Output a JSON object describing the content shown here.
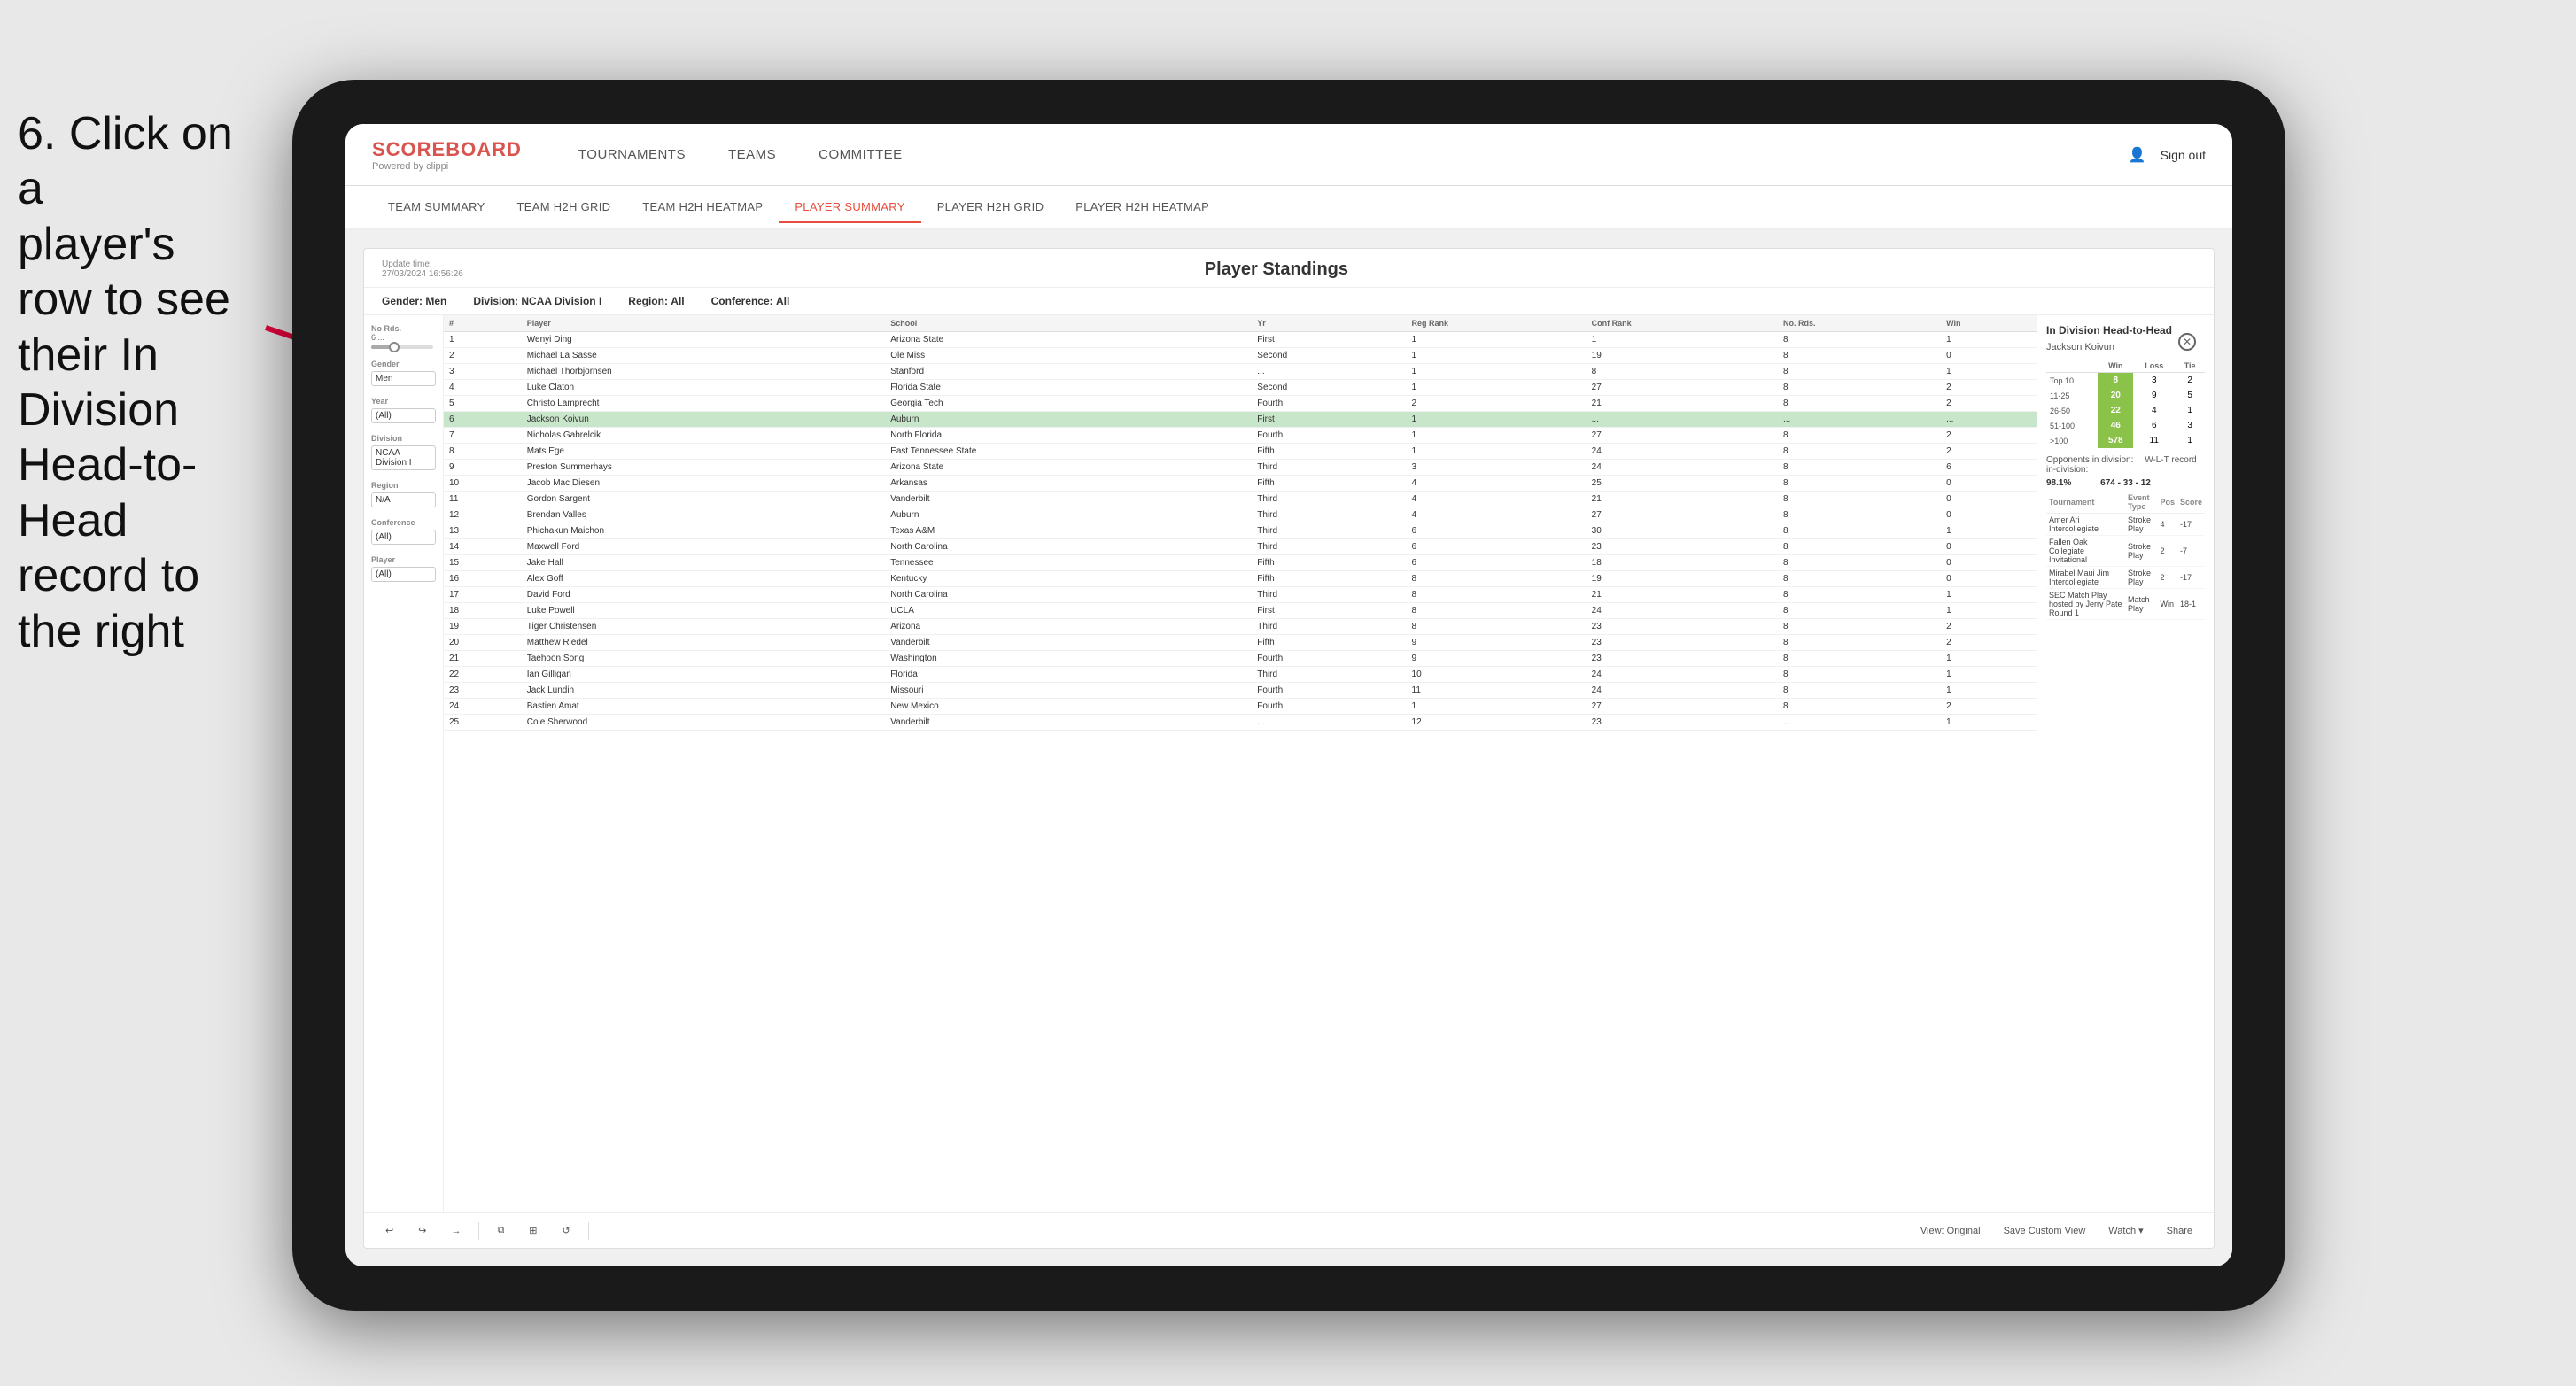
{
  "instruction": {
    "line1": "6. Click on a",
    "line2": "player's row to see",
    "line3": "their In Division",
    "line4": "Head-to-Head",
    "line5": "record to the right"
  },
  "nav": {
    "logo": "SCOREBOARD",
    "powered_by": "Powered by clippi",
    "items": [
      "TOURNAMENTS",
      "TEAMS",
      "COMMITTEE"
    ],
    "sign_out": "Sign out"
  },
  "sub_nav": {
    "items": [
      "TEAM SUMMARY",
      "TEAM H2H GRID",
      "TEAM H2H HEATMAP",
      "PLAYER SUMMARY",
      "PLAYER H2H GRID",
      "PLAYER H2H HEATMAP"
    ],
    "active": "PLAYER SUMMARY"
  },
  "panel": {
    "update_time": "Update time:",
    "update_date": "27/03/2024 16:56:26",
    "title": "Player Standings",
    "filters": {
      "gender_label": "Gender:",
      "gender_value": "Men",
      "division_label": "Division:",
      "division_value": "NCAA Division I",
      "region_label": "Region:",
      "region_value": "All",
      "conference_label": "Conference:",
      "conference_value": "All"
    }
  },
  "sidebar": {
    "no_rds_label": "No Rds.",
    "no_rds_range": "6 ...",
    "gender_label": "Gender",
    "gender_value": "Men",
    "year_label": "Year",
    "year_value": "(All)",
    "division_label": "Division",
    "division_value": "NCAA Division I",
    "region_label": "Region",
    "region_value": "N/A",
    "conference_label": "Conference",
    "conference_value": "(All)",
    "player_label": "Player",
    "player_value": "(All)"
  },
  "table": {
    "headers": [
      "#",
      "Player",
      "School",
      "Yr",
      "Reg Rank",
      "Conf Rank",
      "No. Rds.",
      "Win"
    ],
    "rows": [
      {
        "rank": "1",
        "player": "Wenyi Ding",
        "school": "Arizona State",
        "yr": "First",
        "reg": "1",
        "conf": "1",
        "rds": "8",
        "win": "1",
        "selected": false
      },
      {
        "rank": "2",
        "player": "Michael La Sasse",
        "school": "Ole Miss",
        "yr": "Second",
        "reg": "1",
        "conf": "19",
        "rds": "8",
        "win": "0",
        "selected": false
      },
      {
        "rank": "3",
        "player": "Michael Thorbjornsen",
        "school": "Stanford",
        "yr": "...",
        "reg": "1",
        "conf": "8",
        "rds": "8",
        "win": "1",
        "selected": false
      },
      {
        "rank": "4",
        "player": "Luke Claton",
        "school": "Florida State",
        "yr": "Second",
        "reg": "1",
        "conf": "27",
        "rds": "8",
        "win": "2",
        "selected": false
      },
      {
        "rank": "5",
        "player": "Christo Lamprecht",
        "school": "Georgia Tech",
        "yr": "Fourth",
        "reg": "2",
        "conf": "21",
        "rds": "8",
        "win": "2",
        "selected": false
      },
      {
        "rank": "6",
        "player": "Jackson Koivun",
        "school": "Auburn",
        "yr": "First",
        "reg": "1",
        "conf": "...",
        "rds": "...",
        "win": "...",
        "selected": true
      },
      {
        "rank": "7",
        "player": "Nicholas Gabrelcik",
        "school": "North Florida",
        "yr": "Fourth",
        "reg": "1",
        "conf": "27",
        "rds": "8",
        "win": "2",
        "selected": false
      },
      {
        "rank": "8",
        "player": "Mats Ege",
        "school": "East Tennessee State",
        "yr": "Fifth",
        "reg": "1",
        "conf": "24",
        "rds": "8",
        "win": "2",
        "selected": false
      },
      {
        "rank": "9",
        "player": "Preston Summerhays",
        "school": "Arizona State",
        "yr": "Third",
        "reg": "3",
        "conf": "24",
        "rds": "8",
        "win": "6",
        "selected": false
      },
      {
        "rank": "10",
        "player": "Jacob Mac Diesen",
        "school": "Arkansas",
        "yr": "Fifth",
        "reg": "4",
        "conf": "25",
        "rds": "8",
        "win": "0",
        "selected": false
      },
      {
        "rank": "11",
        "player": "Gordon Sargent",
        "school": "Vanderbilt",
        "yr": "Third",
        "reg": "4",
        "conf": "21",
        "rds": "8",
        "win": "0",
        "selected": false
      },
      {
        "rank": "12",
        "player": "Brendan Valles",
        "school": "Auburn",
        "yr": "Third",
        "reg": "4",
        "conf": "27",
        "rds": "8",
        "win": "0",
        "selected": false
      },
      {
        "rank": "13",
        "player": "Phichakun Maichon",
        "school": "Texas A&M",
        "yr": "Third",
        "reg": "6",
        "conf": "30",
        "rds": "8",
        "win": "1",
        "selected": false
      },
      {
        "rank": "14",
        "player": "Maxwell Ford",
        "school": "North Carolina",
        "yr": "Third",
        "reg": "6",
        "conf": "23",
        "rds": "8",
        "win": "0",
        "selected": false
      },
      {
        "rank": "15",
        "player": "Jake Hall",
        "school": "Tennessee",
        "yr": "Fifth",
        "reg": "6",
        "conf": "18",
        "rds": "8",
        "win": "0",
        "selected": false
      },
      {
        "rank": "16",
        "player": "Alex Goff",
        "school": "Kentucky",
        "yr": "Fifth",
        "reg": "8",
        "conf": "19",
        "rds": "8",
        "win": "0",
        "selected": false
      },
      {
        "rank": "17",
        "player": "David Ford",
        "school": "North Carolina",
        "yr": "Third",
        "reg": "8",
        "conf": "21",
        "rds": "8",
        "win": "1",
        "selected": false
      },
      {
        "rank": "18",
        "player": "Luke Powell",
        "school": "UCLA",
        "yr": "First",
        "reg": "8",
        "conf": "24",
        "rds": "8",
        "win": "1",
        "selected": false
      },
      {
        "rank": "19",
        "player": "Tiger Christensen",
        "school": "Arizona",
        "yr": "Third",
        "reg": "8",
        "conf": "23",
        "rds": "8",
        "win": "2",
        "selected": false
      },
      {
        "rank": "20",
        "player": "Matthew Riedel",
        "school": "Vanderbilt",
        "yr": "Fifth",
        "reg": "9",
        "conf": "23",
        "rds": "8",
        "win": "2",
        "selected": false
      },
      {
        "rank": "21",
        "player": "Taehoon Song",
        "school": "Washington",
        "yr": "Fourth",
        "reg": "9",
        "conf": "23",
        "rds": "8",
        "win": "1",
        "selected": false
      },
      {
        "rank": "22",
        "player": "Ian Gilligan",
        "school": "Florida",
        "yr": "Third",
        "reg": "10",
        "conf": "24",
        "rds": "8",
        "win": "1",
        "selected": false
      },
      {
        "rank": "23",
        "player": "Jack Lundin",
        "school": "Missouri",
        "yr": "Fourth",
        "reg": "11",
        "conf": "24",
        "rds": "8",
        "win": "1",
        "selected": false
      },
      {
        "rank": "24",
        "player": "Bastien Amat",
        "school": "New Mexico",
        "yr": "Fourth",
        "reg": "1",
        "conf": "27",
        "rds": "8",
        "win": "2",
        "selected": false
      },
      {
        "rank": "25",
        "player": "Cole Sherwood",
        "school": "Vanderbilt",
        "yr": "...",
        "reg": "12",
        "conf": "23",
        "rds": "...",
        "win": "1",
        "selected": false
      }
    ]
  },
  "h2h": {
    "title": "In Division Head-to-Head",
    "player": "Jackson Koivun",
    "table_headers": [
      "",
      "Win",
      "Loss",
      "Tie"
    ],
    "rows": [
      {
        "label": "Top 10",
        "win": "8",
        "loss": "3",
        "tie": "2"
      },
      {
        "label": "11-25",
        "win": "20",
        "loss": "9",
        "tie": "5"
      },
      {
        "label": "26-50",
        "win": "22",
        "loss": "4",
        "tie": "1"
      },
      {
        "label": "51-100",
        "win": "46",
        "loss": "6",
        "tie": "3"
      },
      {
        "label": ">100",
        "win": "578",
        "loss": "11",
        "tie": "1"
      }
    ],
    "opponents_label": "Opponents in division:",
    "wl_label": "W-L-T record in-division:",
    "opponents_value": "98.1%",
    "wl_value": "674 - 33 - 12",
    "tournament_headers": [
      "Tournament",
      "Event Type",
      "Pos",
      "Score"
    ],
    "tournaments": [
      {
        "name": "Amer Ari Intercollegiate",
        "type": "Stroke Play",
        "pos": "4",
        "score": "-17"
      },
      {
        "name": "Fallen Oak Collegiate Invitational",
        "type": "Stroke Play",
        "pos": "2",
        "score": "-7"
      },
      {
        "name": "Mirabel Maui Jim Intercollegiate",
        "type": "Stroke Play",
        "pos": "2",
        "score": "-17"
      },
      {
        "name": "SEC Match Play hosted by Jerry Pate Round 1",
        "type": "Match Play",
        "pos": "Win",
        "score": "18-1"
      }
    ]
  },
  "toolbar": {
    "undo": "↩",
    "redo": "↪",
    "forward": "→",
    "copy": "⧉",
    "paste": "⊞",
    "refresh": "↺",
    "view_original": "View: Original",
    "save_custom": "Save Custom View",
    "watch": "Watch ▾",
    "share": "Share"
  }
}
